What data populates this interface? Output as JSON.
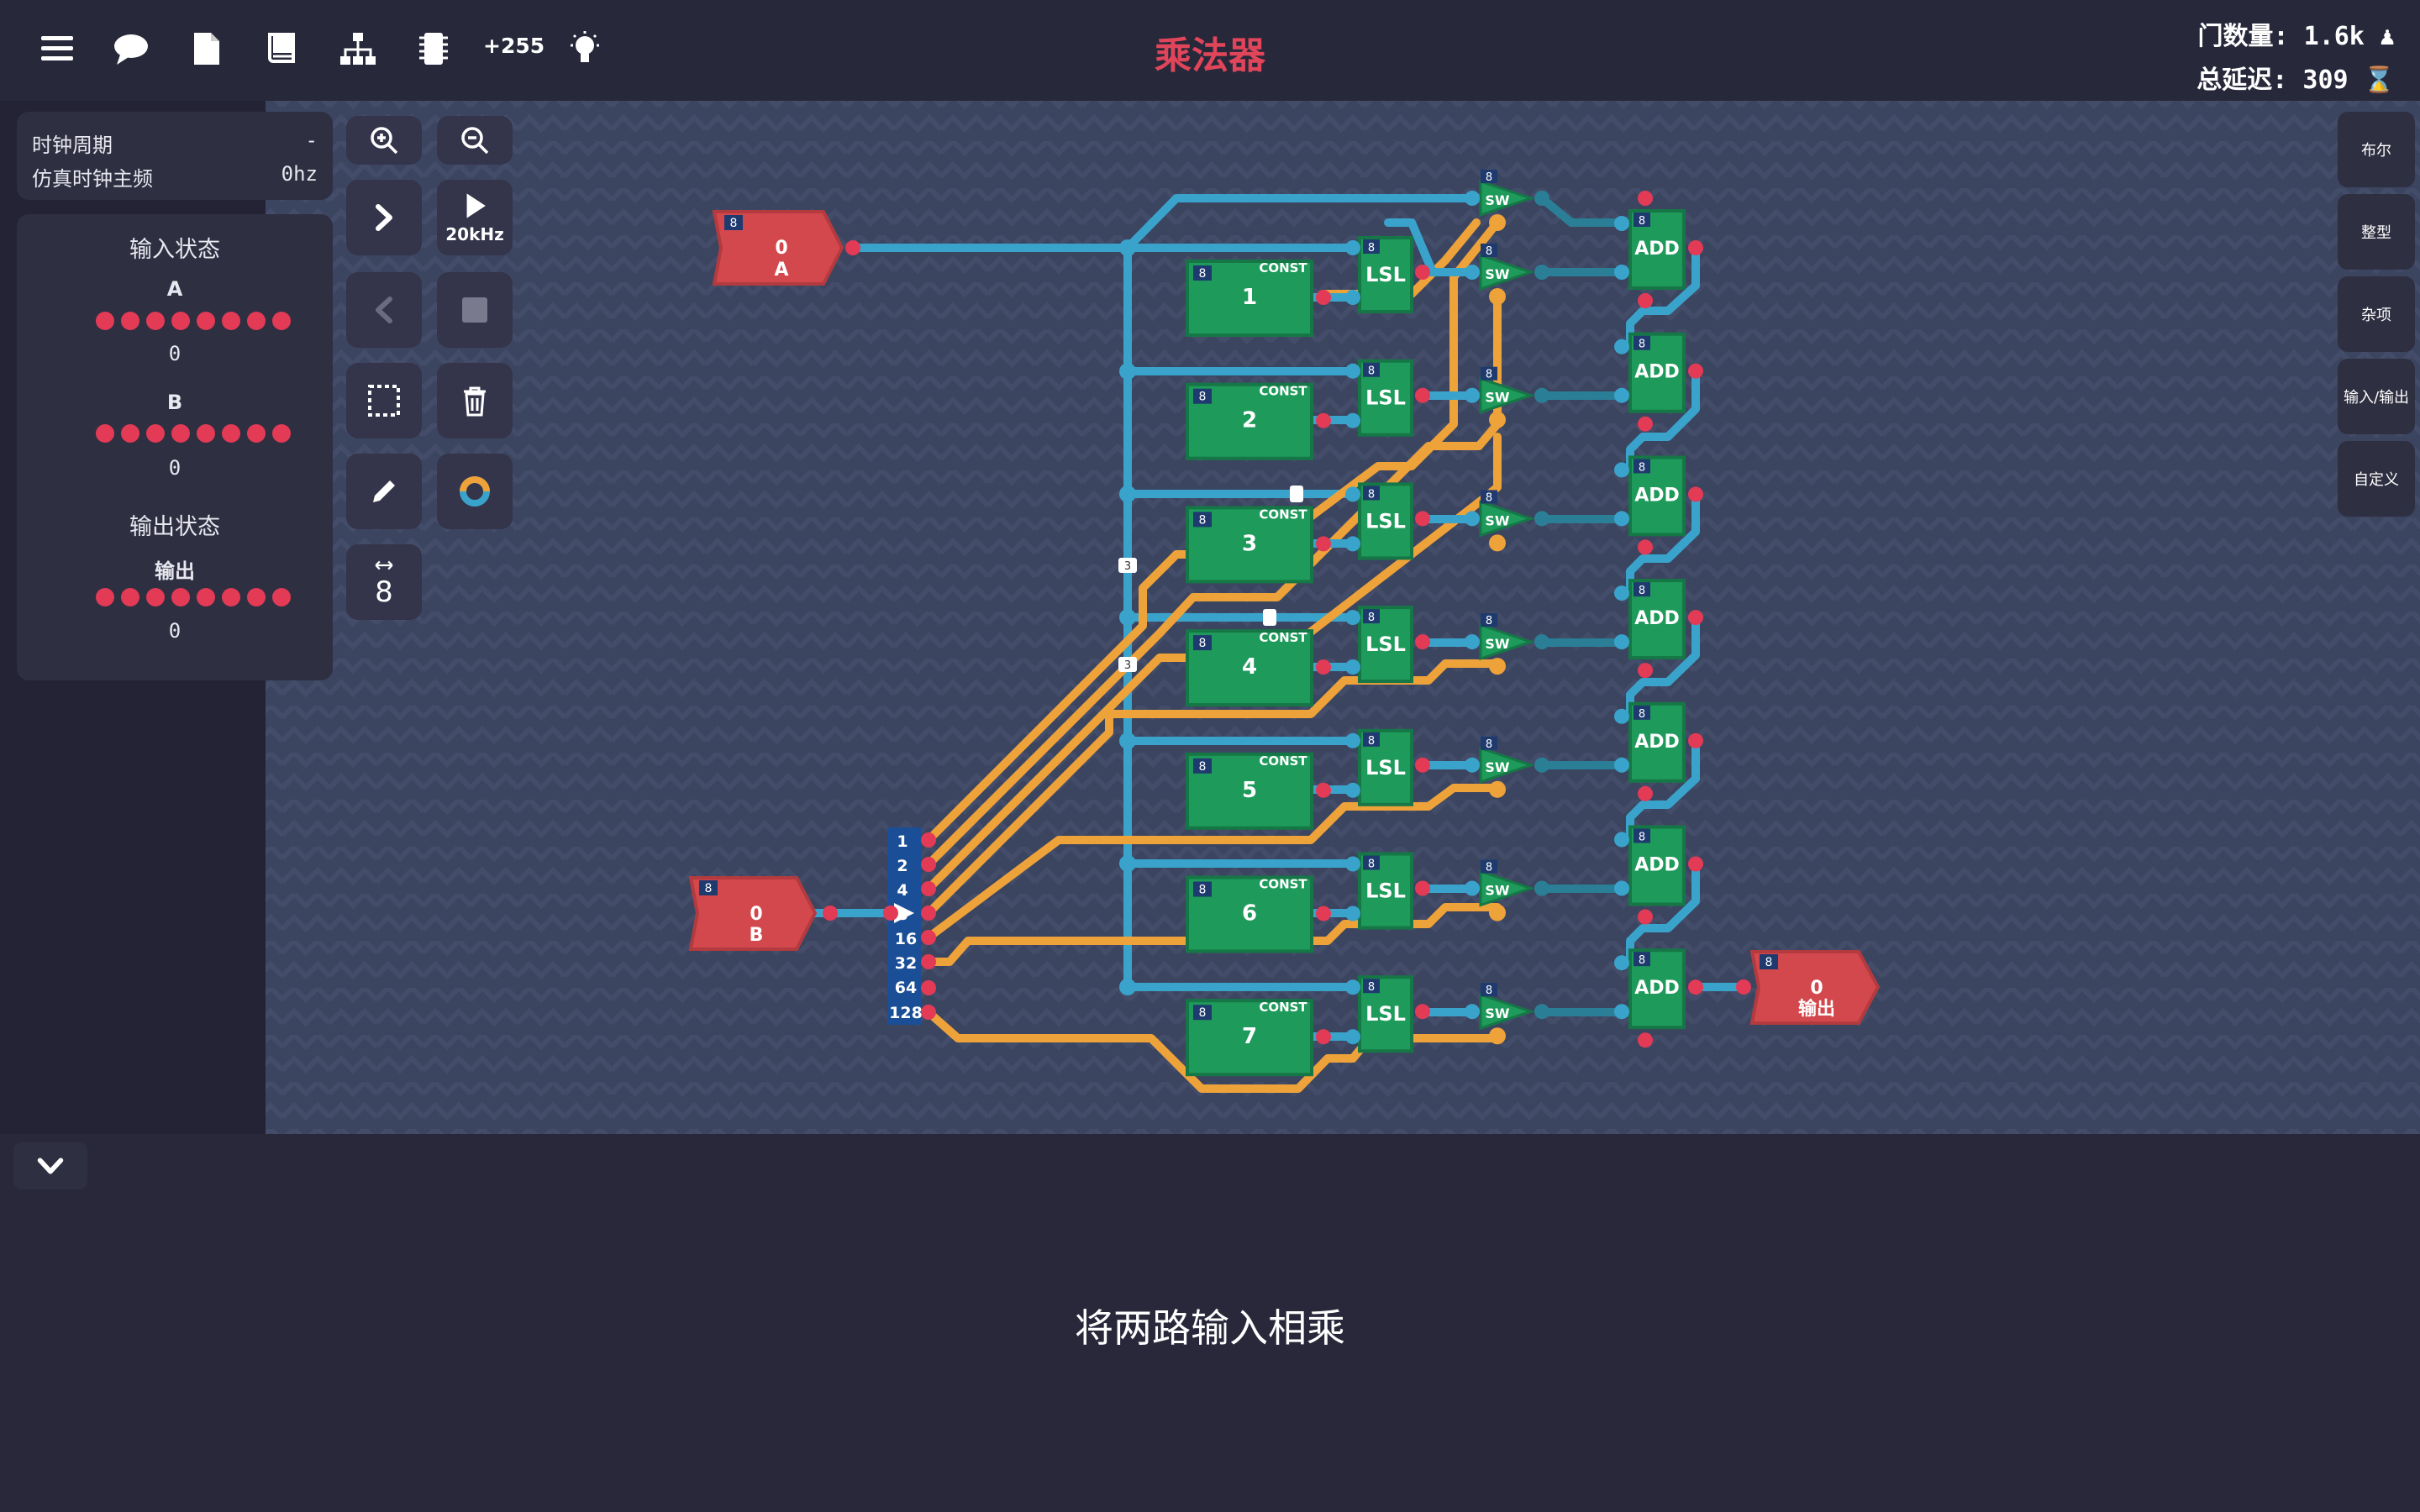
{
  "header": {
    "title": "乘法器",
    "count_label": "+255",
    "gate_count": "门数量: 1.6k",
    "total_delay": "总延迟: 309"
  },
  "clock_panel": {
    "period_label": "时钟周期",
    "period_value": "-",
    "freq_label": "仿真时钟主频",
    "freq_value": "0hz"
  },
  "state_panel": {
    "input_title": "输入状态",
    "input_a_name": "A",
    "input_a_value": "0",
    "input_b_name": "B",
    "input_b_value": "0",
    "output_title": "输出状态",
    "output_name": "输出",
    "output_value": "0"
  },
  "toolbar": {
    "speed_label": "20kHz",
    "bit_width": "8"
  },
  "right_tabs": [
    "布尔",
    "整型",
    "杂项",
    "输入/输出",
    "自定义"
  ],
  "description": "将两路输入相乘",
  "circuit": {
    "input_a": {
      "width": "8",
      "value": "0",
      "name": "A"
    },
    "input_b": {
      "width": "8",
      "value": "0",
      "name": "B"
    },
    "output": {
      "width": "8",
      "value": "0",
      "name": "输出"
    },
    "splitter_labels": [
      "1",
      "2",
      "4",
      "8",
      "16",
      "32",
      "64",
      "128"
    ],
    "const_label": "CONST",
    "const_values": [
      "1",
      "2",
      "3",
      "4",
      "5",
      "6",
      "7"
    ],
    "lsl_label": "LSL",
    "sw_label": "SW",
    "add_label": "ADD",
    "bus_width": "8",
    "wire_labels": [
      "3",
      "3"
    ]
  },
  "colors": {
    "accent_red": "#d3484d",
    "gate_green": "#1e9a5a",
    "wire_blue": "#3aa3cc",
    "wire_orange": "#eea23a",
    "title_red": "#e0455a"
  }
}
